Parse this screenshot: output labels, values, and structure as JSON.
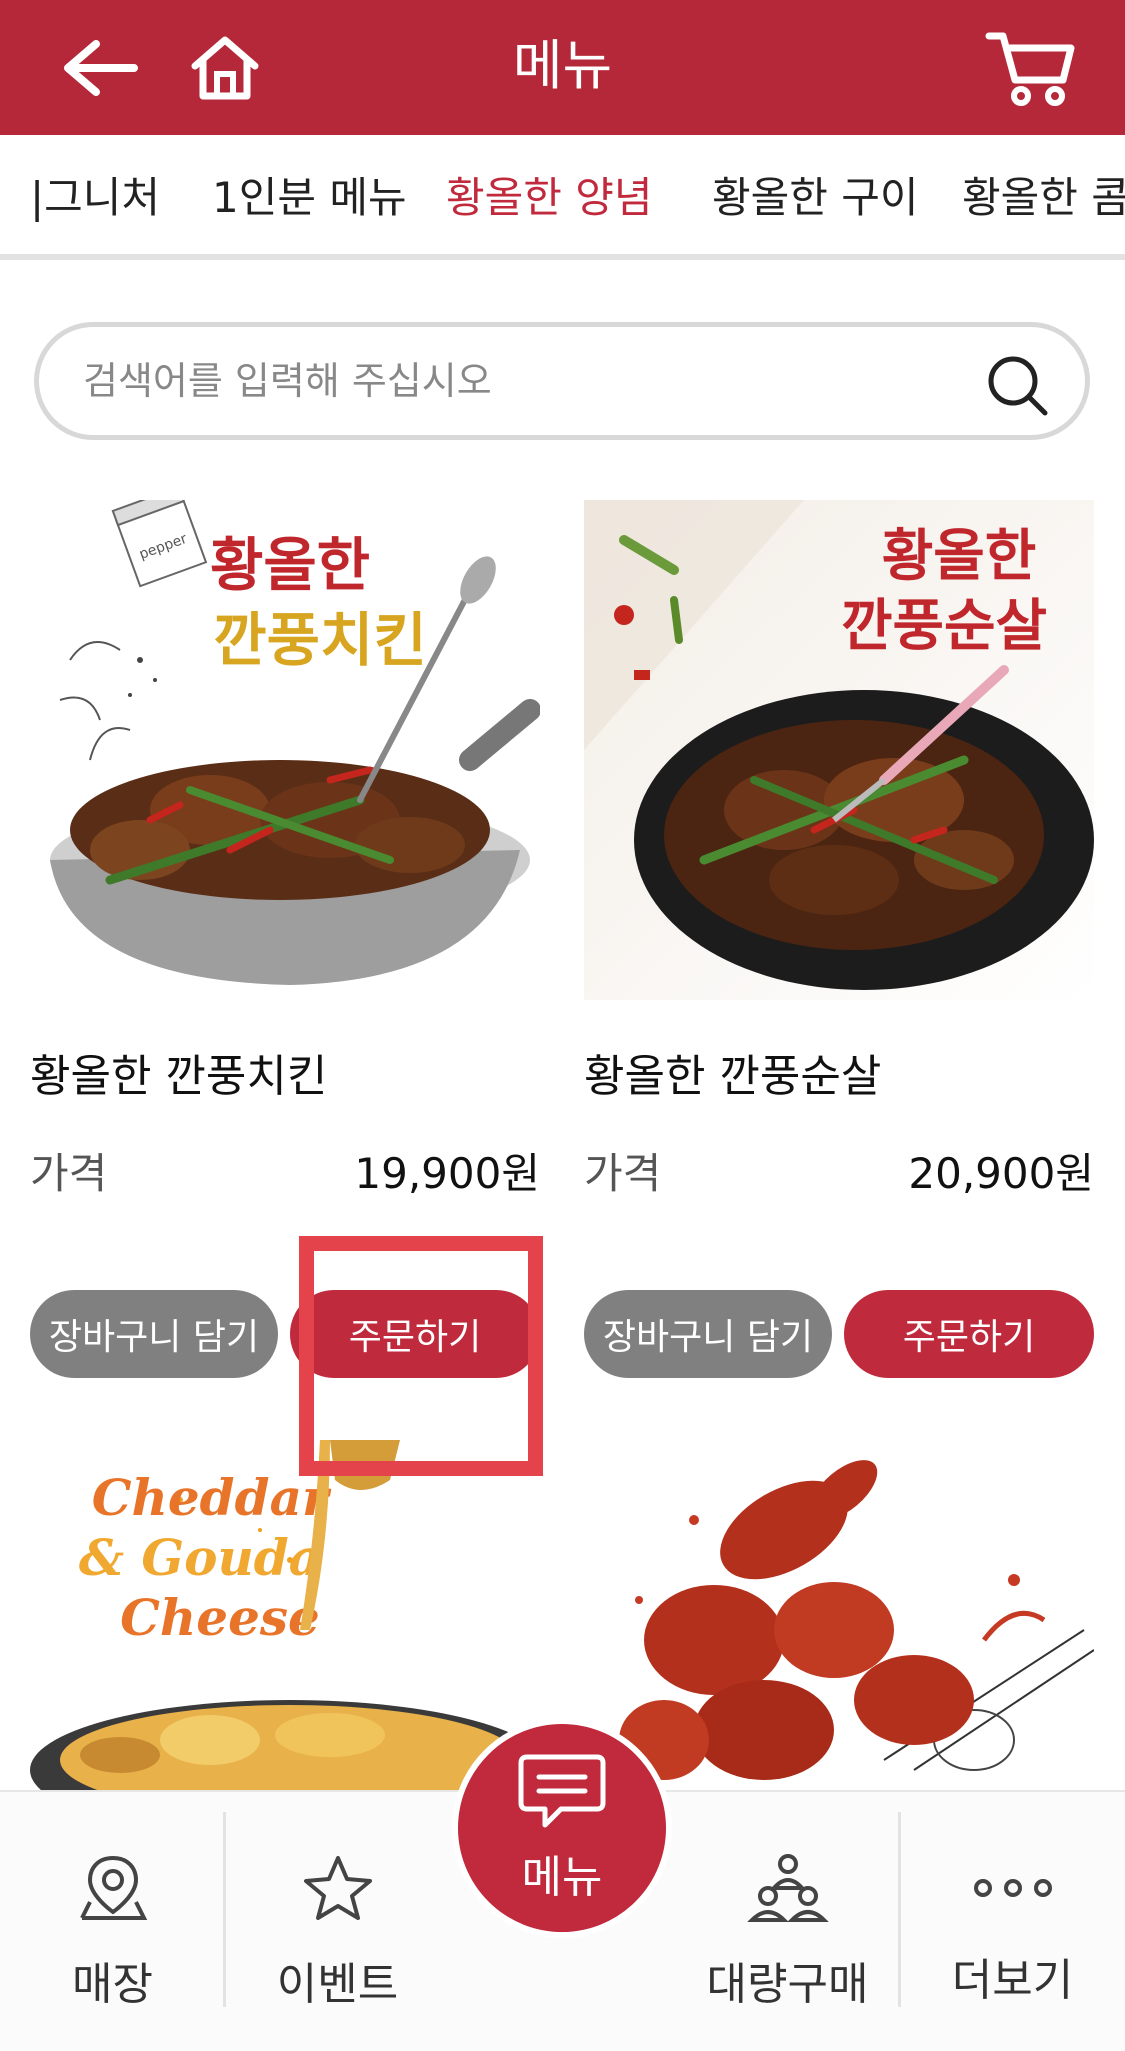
{
  "header": {
    "title": "메뉴",
    "icons": [
      "arrow-left-icon",
      "home-icon",
      "cart-icon"
    ]
  },
  "tabs": [
    {
      "label": "시그니처",
      "display": "|그니처"
    },
    {
      "label": "1인분 메뉴"
    },
    {
      "label": "황올한 양념",
      "active": true
    },
    {
      "label": "황올한 구이"
    },
    {
      "label": "황올한 콤",
      "display": "황올한 콤"
    }
  ],
  "search": {
    "placeholder": "검색어를 입력해 주십시오",
    "value": ""
  },
  "products": [
    {
      "name": "황올한 깐풍치킨",
      "price_label": "가격",
      "price": "19,900원",
      "image_text_1": "황올한",
      "image_text_2": "깐풍치킨",
      "image_text_3": "pepper",
      "cart_button": "장바구니 담기",
      "order_button": "주문하기"
    },
    {
      "name": "황올한 깐풍순살",
      "price_label": "가격",
      "price": "20,900원",
      "image_text_1": "황올한",
      "image_text_2": "깐풍순살",
      "cart_button": "장바구니 담기",
      "order_button": "주문하기"
    },
    {
      "image_text_1": "Cheddar",
      "image_text_2": "& Gouda",
      "image_text_3": "Cheese"
    },
    {}
  ],
  "bottom_nav": {
    "items": [
      {
        "label": "매장",
        "icon": "map-pin-icon"
      },
      {
        "label": "이벤트",
        "icon": "star-icon"
      },
      {
        "label": "메뉴",
        "icon": "chat-menu-icon",
        "active": true
      },
      {
        "label": "대량구매",
        "icon": "group-icon"
      },
      {
        "label": "더보기",
        "icon": "more-icon"
      }
    ]
  },
  "colors": {
    "brand": "#b5283a",
    "order_button": "#c02a3d",
    "cart_button": "#808080",
    "active_tab": "#c12a3d",
    "highlight": "#e5434b"
  }
}
